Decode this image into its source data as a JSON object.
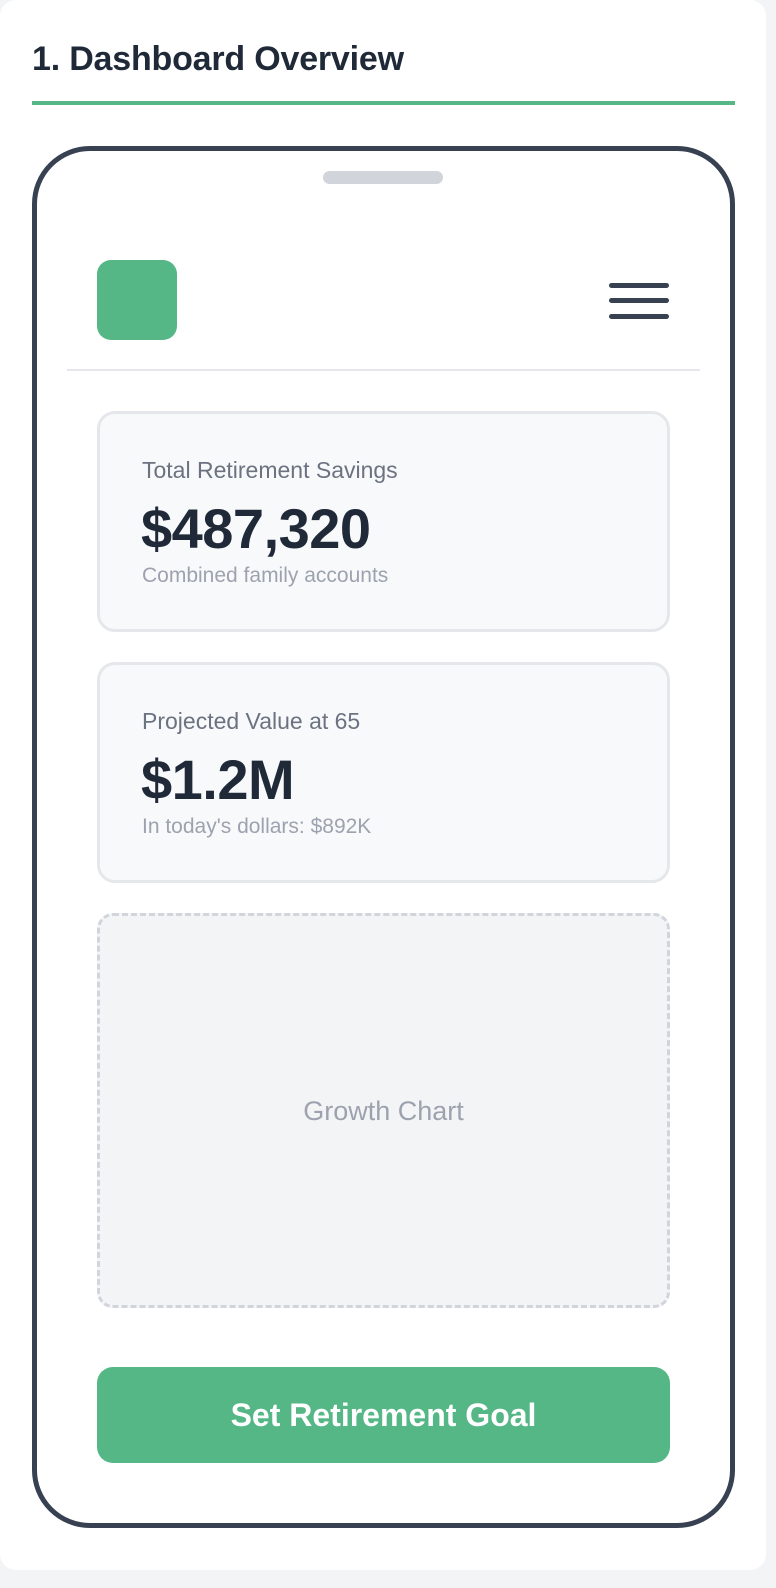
{
  "section": {
    "title": "1. Dashboard Overview"
  },
  "colors": {
    "accent": "#55b785",
    "phone_frame": "#374151",
    "text_primary": "#1f2937",
    "text_secondary": "#6b7280",
    "text_muted": "#9ca3af"
  },
  "app_header": {
    "logo_icon": "app-logo-placeholder",
    "menu_icon": "hamburger-menu-icon"
  },
  "cards": [
    {
      "label": "Total Retirement Savings",
      "value": "$487,320",
      "subtext": "Combined family accounts"
    },
    {
      "label": "Projected Value at 65",
      "value": "$1.2M",
      "subtext": "In today's dollars: $892K"
    }
  ],
  "chart_placeholder": {
    "label": "Growth Chart"
  },
  "cta": {
    "label": "Set Retirement Goal"
  }
}
